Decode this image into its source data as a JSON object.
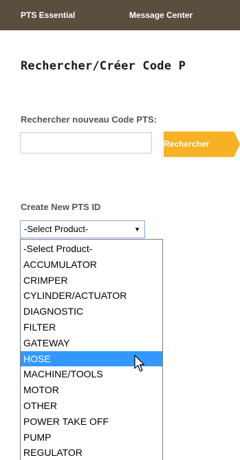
{
  "nav": {
    "items": [
      "PTS Essential",
      "Message Center"
    ]
  },
  "page": {
    "title": "Rechercher/Créer Code P"
  },
  "search": {
    "label": "Rechercher nouveau Code PTS:",
    "value": "",
    "placeholder": "",
    "button_label": "Rechercher"
  },
  "create": {
    "label": "Create New PTS ID",
    "selected_value": "-Select Product-",
    "options": [
      "-Select Product-",
      "ACCUMULATOR",
      "CRIMPER",
      "CYLINDER/ACTUATOR",
      "DIAGNOSTIC",
      "FILTER",
      "GATEWAY",
      "HOSE",
      "MACHINE/TOOLS",
      "MOTOR",
      "OTHER",
      "POWER TAKE OFF",
      "PUMP",
      "REGULATOR"
    ],
    "highlighted_option": "HOSE"
  },
  "colors": {
    "nav_background": "#5a4f3f",
    "button_accent": "#f7b224",
    "highlight": "#3399ff"
  },
  "icons": {
    "cursor": "pointer-cursor-icon",
    "dropdown_arrow": "triangle-down-icon"
  }
}
